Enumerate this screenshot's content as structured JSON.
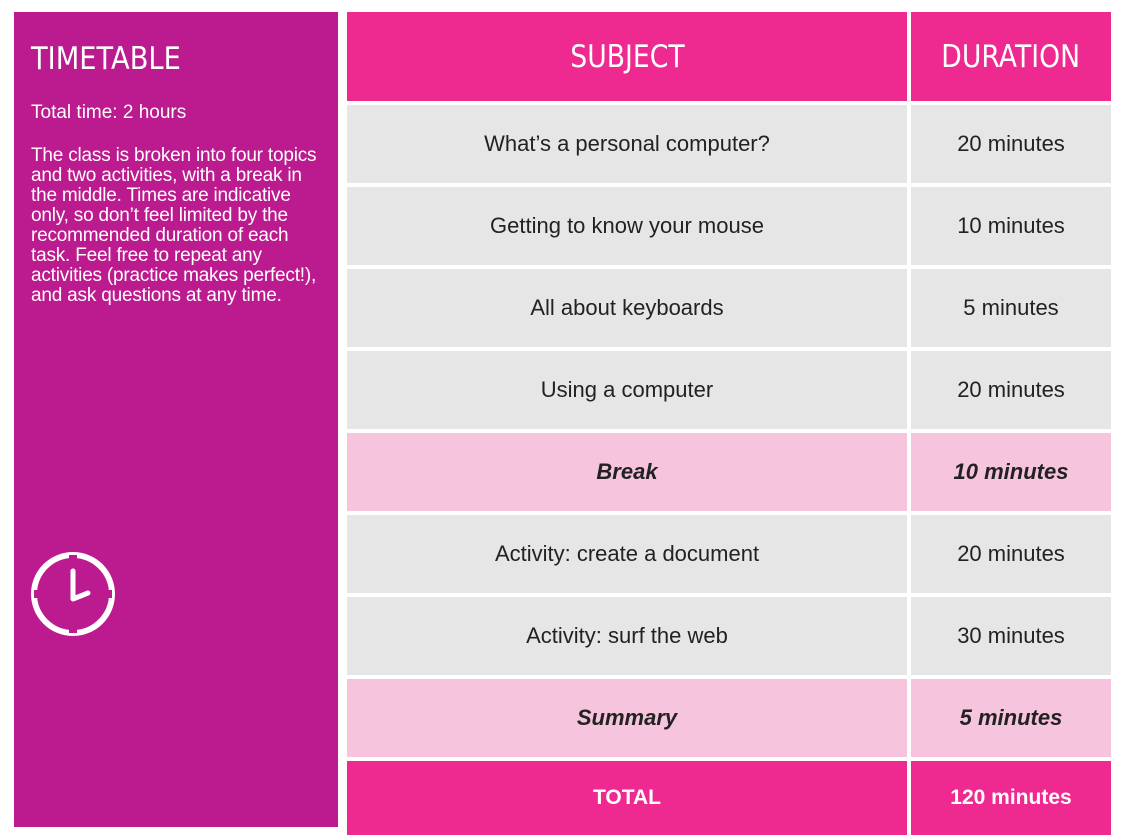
{
  "sidebar": {
    "title": "TIMETABLE",
    "total_time": "Total time: 2 hours",
    "description": "The class is broken into four topics and two activities, with a break in the middle. Times are indicative only, so don’t feel limited by the recommended duration of each task. Feel free to repeat any activities (practice makes perfect!), and ask questions at any time.",
    "icon": "clock-icon"
  },
  "table": {
    "headers": {
      "subject": "SUBJECT",
      "duration": "DURATION"
    },
    "rows": [
      {
        "subject": "What’s a personal computer?",
        "duration": "20 minutes",
        "highlight": false
      },
      {
        "subject": "Getting to know your mouse",
        "duration": "10 minutes",
        "highlight": false
      },
      {
        "subject": "All about keyboards",
        "duration": "5 minutes",
        "highlight": false
      },
      {
        "subject": "Using a computer",
        "duration": "20 minutes",
        "highlight": false
      },
      {
        "subject": "Break",
        "duration": "10 minutes",
        "highlight": true
      },
      {
        "subject": "Activity: create a document",
        "duration": "20 minutes",
        "highlight": false
      },
      {
        "subject": "Activity: surf the web",
        "duration": "30 minutes",
        "highlight": false
      },
      {
        "subject": "Summary",
        "duration": "5 minutes",
        "highlight": true
      }
    ],
    "total": {
      "label": "TOTAL",
      "duration": "120 minutes"
    }
  },
  "colors": {
    "sidebar_bg": "#bb1b8e",
    "header_bg": "#ee2990",
    "row_bg": "#e6e6e6",
    "highlight_bg": "#f7c4dd"
  }
}
